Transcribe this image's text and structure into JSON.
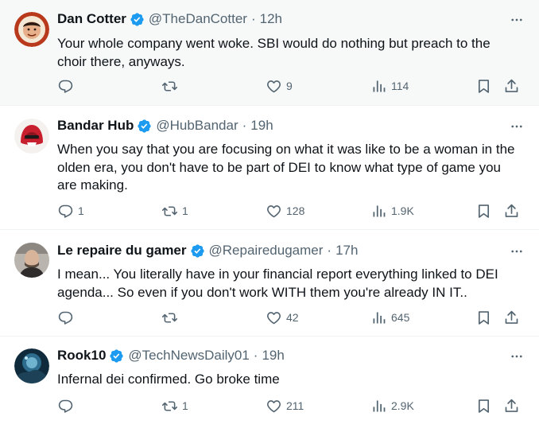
{
  "tweets": [
    {
      "name": "Dan Cotter",
      "handle": "@TheDanCotter",
      "separator": "·",
      "time": "12h",
      "text": "Your whole company went woke. SBI would do nothing but preach to the choir there, anyways.",
      "replies": "",
      "reposts": "",
      "likes": "9",
      "views": "114"
    },
    {
      "name": "Bandar Hub",
      "handle": "@HubBandar",
      "separator": "·",
      "time": "19h",
      "text": "When you say that you are focusing on what it was like to be a woman in the olden era, you don't have to be part of DEI to know what type of game you are making.",
      "replies": "1",
      "reposts": "1",
      "likes": "128",
      "views": "1.9K"
    },
    {
      "name": "Le repaire du gamer",
      "handle": "@Repairedugamer",
      "separator": "·",
      "time": "17h",
      "text": "I mean... You literally have in your financial report everything linked to DEI agenda... So even if you don't work WITH them you're already IN IT..",
      "replies": "",
      "reposts": "",
      "likes": "42",
      "views": "645"
    },
    {
      "name": "Rook10",
      "handle": "@TechNewsDaily01",
      "separator": "·",
      "time": "19h",
      "text": "Infernal dei confirmed. Go broke time",
      "replies": "",
      "reposts": "1",
      "likes": "211",
      "views": "2.9K"
    }
  ],
  "icons": {
    "verified": "verified-badge-icon",
    "more": "more-icon",
    "reply": "reply-icon",
    "repost": "repost-icon",
    "like": "like-icon",
    "views": "views-icon",
    "bookmark": "bookmark-icon",
    "share": "share-icon"
  },
  "colors": {
    "verified": "#1d9bf0",
    "text": "#0f1419",
    "muted": "#536471",
    "highlight_bg": "#f7f9f9"
  }
}
